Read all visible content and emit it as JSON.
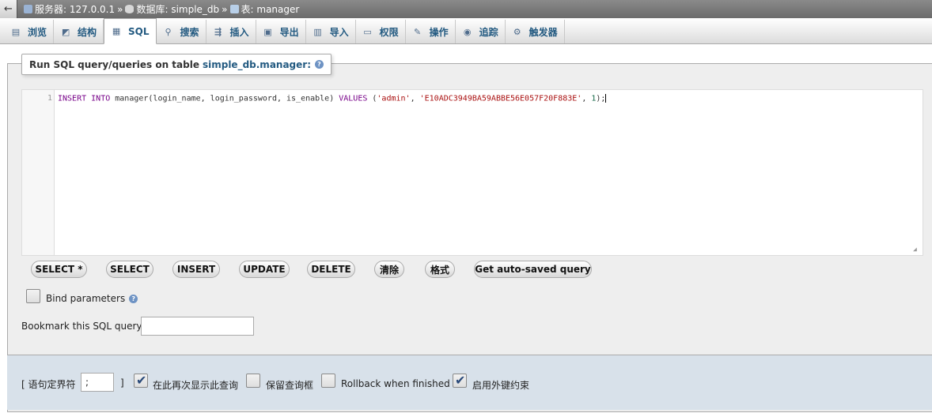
{
  "topbar": {
    "back_label": "←",
    "server_label": "服务器: 127.0.0.1",
    "database_label": "数据库: simple_db",
    "table_label": "表: manager",
    "separator": "»"
  },
  "tabs": [
    {
      "label": "浏览",
      "icon": "browse-icon"
    },
    {
      "label": "结构",
      "icon": "structure-icon"
    },
    {
      "label": "SQL",
      "icon": "sql-icon"
    },
    {
      "label": "搜索",
      "icon": "search-icon"
    },
    {
      "label": "插入",
      "icon": "insert-icon"
    },
    {
      "label": "导出",
      "icon": "export-icon"
    },
    {
      "label": "导入",
      "icon": "import-icon"
    },
    {
      "label": "权限",
      "icon": "privileges-icon"
    },
    {
      "label": "操作",
      "icon": "operations-icon"
    },
    {
      "label": "追踪",
      "icon": "tracking-icon"
    },
    {
      "label": "触发器",
      "icon": "triggers-icon"
    }
  ],
  "active_tab": "SQL",
  "query_box": {
    "legend_prefix": "Run SQL query/queries on table",
    "legend_table": "simple_db.manager:",
    "line_number": "1",
    "tokens": {
      "insert": "INSERT",
      "into": "INTO",
      "table_cols": " manager(login_name, login_password, is_enable) ",
      "values": "VALUES",
      "open": " (",
      "str1": "'admin'",
      "comma1": ", ",
      "str2": "'E10ADC3949BA59ABBE56E057F20F883E'",
      "comma2": ", ",
      "num": "1",
      "close": ");"
    }
  },
  "buttons": {
    "select_star": "SELECT *",
    "select": "SELECT",
    "insert": "INSERT",
    "update": "UPDATE",
    "delete": "DELETE",
    "clear": "清除",
    "format": "格式",
    "autosaved": "Get auto-saved query"
  },
  "bind_parameters": {
    "label": "Bind parameters",
    "checked": false
  },
  "bookmark": {
    "label": "Bookmark this SQL query:",
    "value": ""
  },
  "options": {
    "delimiter_open": "[ 语句定界符",
    "delimiter_value": ";",
    "delimiter_close": "]",
    "show_again_label": "在此再次显示此查询",
    "show_again_checked": true,
    "retain_box_label": "保留查询框",
    "retain_box_checked": false,
    "rollback_label": "Rollback when finished",
    "rollback_checked": false,
    "fk_label": "启用外键约束",
    "fk_checked": true
  },
  "colors": {
    "link": "#235a81",
    "keyword": "#770088",
    "string": "#aa1111",
    "number": "#116644",
    "bottom_bg": "#d8e1ea"
  }
}
